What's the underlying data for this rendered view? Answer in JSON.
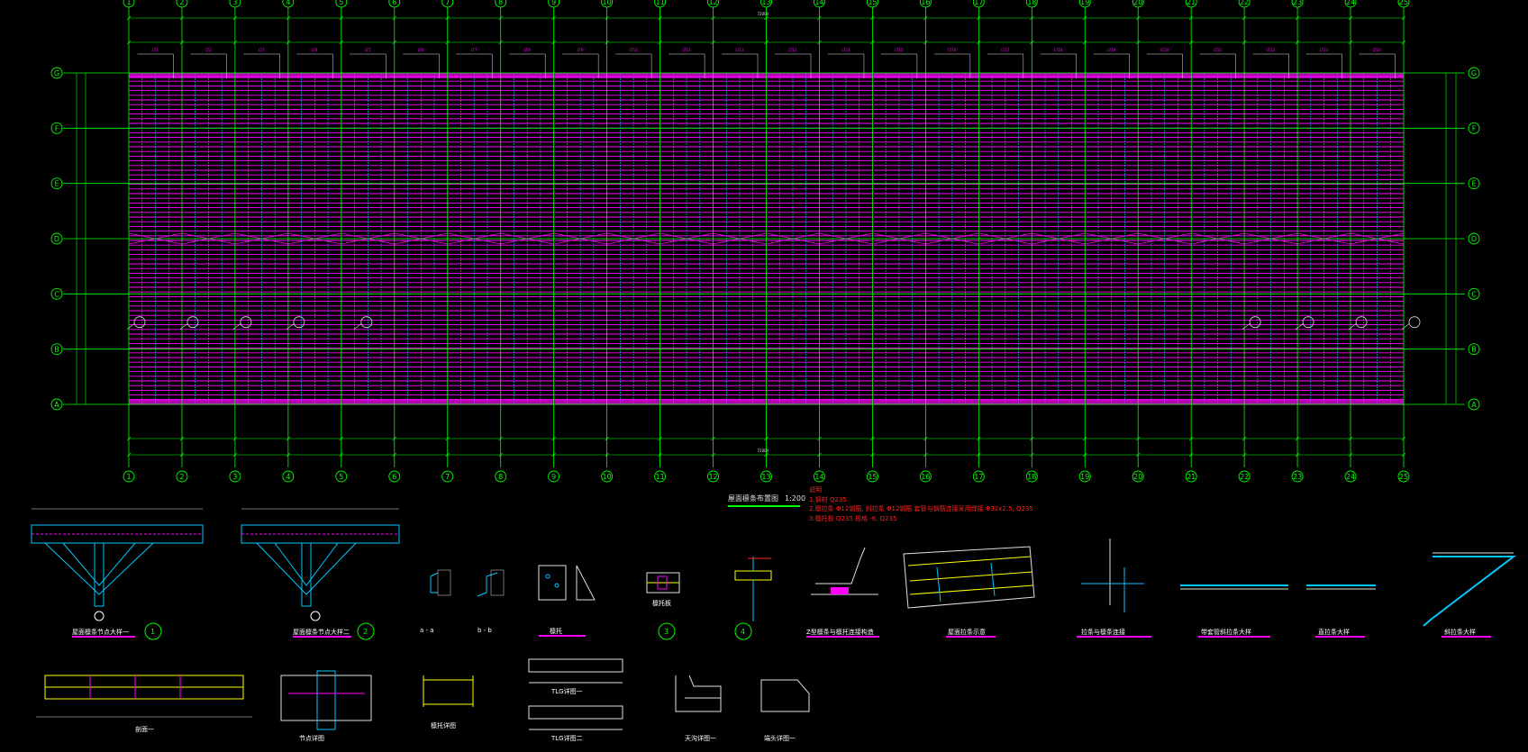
{
  "drawing": {
    "plan_title": "屋面檩条布置图",
    "plan_scale": "1:200",
    "overall_dim": "72000",
    "notes_heading": "说明",
    "notes": [
      "1.钢材 Q235.",
      "2.檩拉条 Φ12钢筋, 斜拉条 Φ12钢筋 套管与钢筋连接采用焊接 Φ32x2.5, Q235",
      "3.檩托板 Q235 规格 -6, Q235"
    ]
  },
  "axes": {
    "columns": [
      "1",
      "2",
      "3",
      "4",
      "5",
      "6",
      "7",
      "8",
      "9",
      "10",
      "11",
      "12",
      "13",
      "14",
      "15",
      "16",
      "17",
      "18",
      "19",
      "20",
      "21",
      "22",
      "23",
      "24",
      "25"
    ],
    "rows": [
      "G",
      "F",
      "E",
      "D",
      "C",
      "B",
      "A"
    ]
  },
  "purlin_labels": [
    "LT1",
    "LT2",
    "LT3",
    "LT4",
    "LT5",
    "LT6",
    "LT7",
    "LT8",
    "LT9",
    "LT10",
    "LT11",
    "LT12",
    "LT13",
    "LT14",
    "LT15",
    "LT16",
    "LT17",
    "LT18",
    "LT19",
    "LT20",
    "LT21",
    "LT22",
    "LT23",
    "LT24"
  ],
  "details": [
    {
      "label": "屋面檩条节点大样一",
      "num": "1"
    },
    {
      "label": "屋面檩条节点大样二",
      "num": "2"
    },
    {
      "label": "a - a"
    },
    {
      "label": "b - b"
    },
    {
      "label": "檩托"
    },
    {
      "label": "檩托板",
      "num": "3"
    },
    {
      "label": "",
      "num": "4"
    },
    {
      "label": "Z型檩条与檩托连接构造"
    },
    {
      "label": "屋面拉条示意"
    },
    {
      "label": "拉条与檩条连接"
    },
    {
      "label": "带套管斜拉条大样"
    },
    {
      "label": "直拉条大样"
    },
    {
      "label": "斜拉条大样"
    },
    {
      "label": "剖面一"
    },
    {
      "label": "节点详图"
    },
    {
      "label": "檩托详图"
    },
    {
      "label": "TLG详图一"
    },
    {
      "label": "TLG详图二"
    },
    {
      "label": "天沟详图一"
    },
    {
      "label": "端头详图一"
    }
  ],
  "colors": {
    "background": "#000000",
    "axis": "#00ff00",
    "purlin": "#ff00ff",
    "tie": "#00c8ff",
    "dimension": "#e0e0e0",
    "note": "#ff2020"
  }
}
